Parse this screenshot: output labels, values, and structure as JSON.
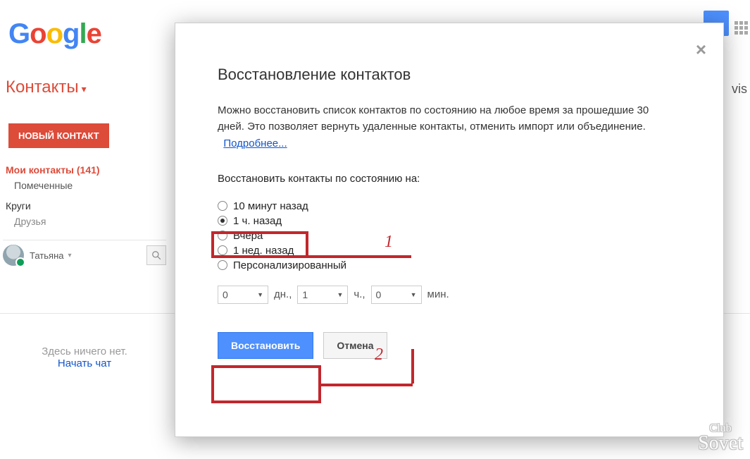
{
  "logo_letters": [
    "G",
    "o",
    "o",
    "g",
    "l",
    "e"
  ],
  "app_title": "Контакты",
  "new_contact_btn": "НОВЫЙ КОНТАКТ",
  "sidebar": {
    "main": "Мои контакты (141)",
    "starred": "Помеченные",
    "circles": "Круги",
    "friends": "Друзья"
  },
  "user_name": "Татьяна",
  "empty_chat_line1": "Здесь ничего нет.",
  "empty_chat_link": "Начать чат",
  "apps_icon_name": "apps-grid-icon",
  "vis_fragment": "vis",
  "dialog": {
    "title": "Восстановление контактов",
    "desc_1": "Можно восстановить список контактов по состоянию на любое время за прошедшие 30 дней. Это позволяет вернуть удаленные контакты, отменить импорт или объединение.",
    "learn_more": "Подробнее...",
    "sub_label": "Восстановить контакты по состоянию на:",
    "options": [
      "10 минут назад",
      "1 ч. назад",
      "Вчера",
      "1 нед. назад",
      "Персонализированный"
    ],
    "selected_index": 1,
    "custom": {
      "days_value": "0",
      "days_label": "дн.,",
      "hours_value": "1",
      "hours_label": "ч.,",
      "mins_value": "0",
      "mins_label": "мин."
    },
    "restore": "Восстановить",
    "cancel": "Отмена"
  },
  "annotations": {
    "n1": "1",
    "n2": "2"
  },
  "watermark": {
    "top": "Club",
    "bottom": "Sovet"
  }
}
